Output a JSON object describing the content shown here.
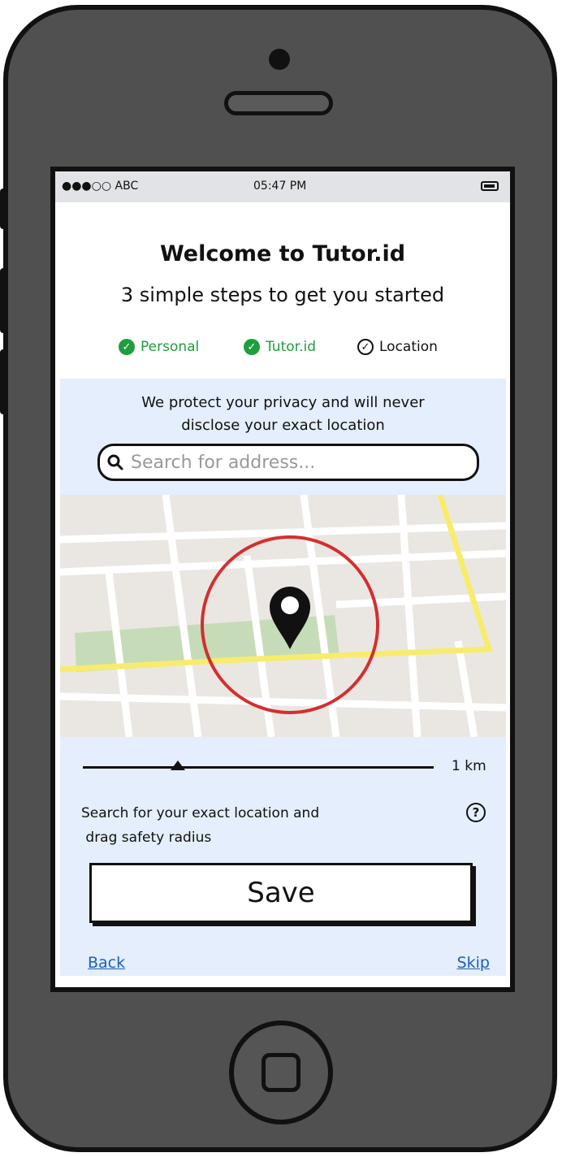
{
  "status_bar": {
    "carrier": "●●●○○ ABC",
    "time": "05:47 PM",
    "battery_icon": "battery-icon"
  },
  "header": {
    "title": "Welcome to Tutor.id",
    "subtitle": "3 simple steps to get you started"
  },
  "steps": [
    {
      "label": "Personal",
      "state": "done",
      "icon": "check-circle-icon"
    },
    {
      "label": "Tutor.id",
      "state": "done",
      "icon": "check-circle-icon"
    },
    {
      "label": "Location",
      "state": "current",
      "icon": "check-circle-outline-icon"
    }
  ],
  "privacy": {
    "line1": "We protect your privacy and will never",
    "line2": "disclose your exact location"
  },
  "search": {
    "placeholder": "Search for address...",
    "value": "",
    "icon": "search-icon"
  },
  "map": {
    "pin_icon": "map-pin-icon",
    "radius_circle_color": "#d32f2f",
    "highway_color": "#f7ec6e",
    "park_color": "#c6dcb8",
    "land_color": "#eae7e2"
  },
  "radius": {
    "value_label": "1 km"
  },
  "hint": {
    "line1": "Search for your exact location and",
    "line2": " drag safety radius",
    "help_icon": "help-icon"
  },
  "actions": {
    "save_label": "Save",
    "back_label": "Back",
    "skip_label": "Skip"
  },
  "colors": {
    "accent_green": "#1e9e3c",
    "panel_bg": "#e4eefc",
    "link": "#1a5fbf"
  }
}
